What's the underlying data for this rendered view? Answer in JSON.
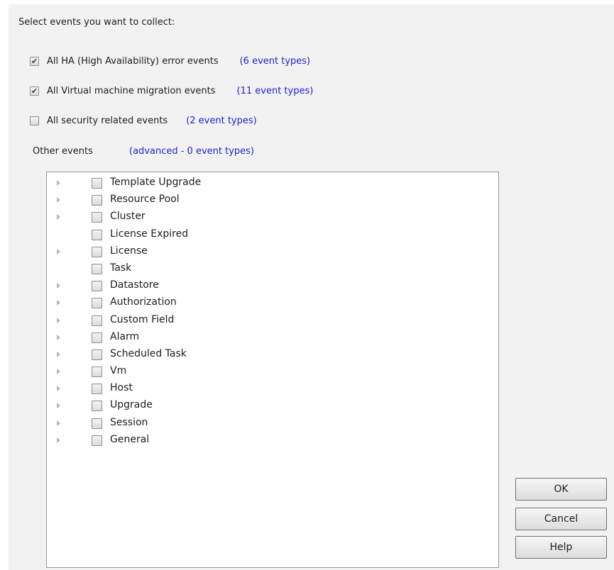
{
  "heading": "Select events you want to collect:",
  "options": [
    {
      "label": "All HA (High Availability) error events",
      "checked": true,
      "link": "(6 event types)"
    },
    {
      "label": "All Virtual machine migration events",
      "checked": true,
      "link": "(11 event types)"
    },
    {
      "label": "All security related events",
      "checked": false,
      "link": "(2 event types)"
    }
  ],
  "other_events": {
    "label": "Other events",
    "link": "(advanced - 0 event types)"
  },
  "tree": [
    {
      "label": "Template Upgrade",
      "expandable": true,
      "checked": false
    },
    {
      "label": "Resource Pool",
      "expandable": true,
      "checked": false
    },
    {
      "label": "Cluster",
      "expandable": true,
      "checked": false
    },
    {
      "label": "License Expired",
      "expandable": false,
      "checked": false
    },
    {
      "label": "License",
      "expandable": true,
      "checked": false
    },
    {
      "label": "Task",
      "expandable": false,
      "checked": false
    },
    {
      "label": "Datastore",
      "expandable": true,
      "checked": false
    },
    {
      "label": "Authorization",
      "expandable": true,
      "checked": false
    },
    {
      "label": "Custom Field",
      "expandable": true,
      "checked": false
    },
    {
      "label": "Alarm",
      "expandable": true,
      "checked": false
    },
    {
      "label": "Scheduled Task",
      "expandable": true,
      "checked": false
    },
    {
      "label": "Vm",
      "expandable": true,
      "checked": false
    },
    {
      "label": "Host",
      "expandable": true,
      "checked": false
    },
    {
      "label": "Upgrade",
      "expandable": true,
      "checked": false
    },
    {
      "label": "Session",
      "expandable": true,
      "checked": false
    },
    {
      "label": "General",
      "expandable": true,
      "checked": false
    }
  ],
  "buttons": {
    "ok": "OK",
    "cancel": "Cancel",
    "help": "Help"
  },
  "colors": {
    "link": "#2222d0",
    "check": "#2a3d68",
    "panel": "#f2f2f2"
  }
}
